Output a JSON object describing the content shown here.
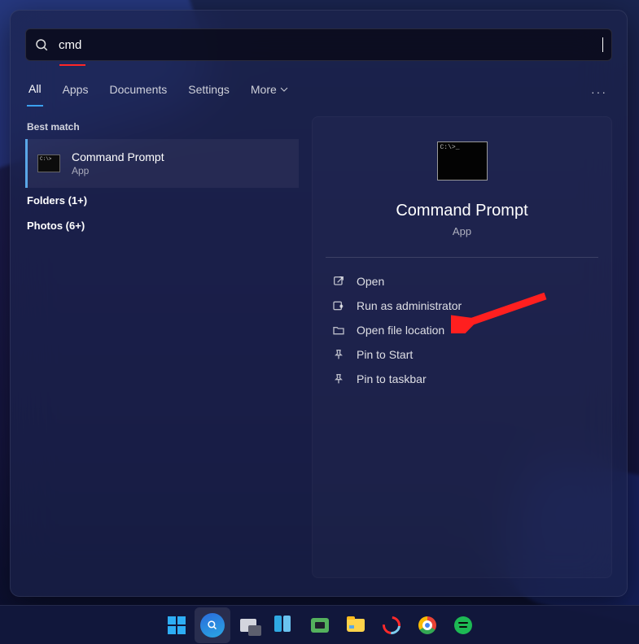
{
  "search": {
    "query": "cmd"
  },
  "tabs": {
    "all": "All",
    "apps": "Apps",
    "documents": "Documents",
    "settings": "Settings",
    "more": "More"
  },
  "left": {
    "best_match_label": "Best match",
    "folders_label": "Folders (1+)",
    "photos_label": "Photos (6+)"
  },
  "best_match": {
    "title": "Command Prompt",
    "subtitle": "App"
  },
  "detail": {
    "title": "Command Prompt",
    "subtitle": "App",
    "actions": {
      "open": "Open",
      "run_admin": "Run as administrator",
      "open_location": "Open file location",
      "pin_start": "Pin to Start",
      "pin_taskbar": "Pin to taskbar"
    }
  },
  "taskbar": {
    "start": "Start",
    "search": "Search",
    "taskview": "Task view",
    "widgets": "Widgets",
    "chat": "Chat",
    "explorer": "File Explorer",
    "opera": "Opera",
    "chrome": "Google Chrome",
    "spotify": "Spotify"
  }
}
